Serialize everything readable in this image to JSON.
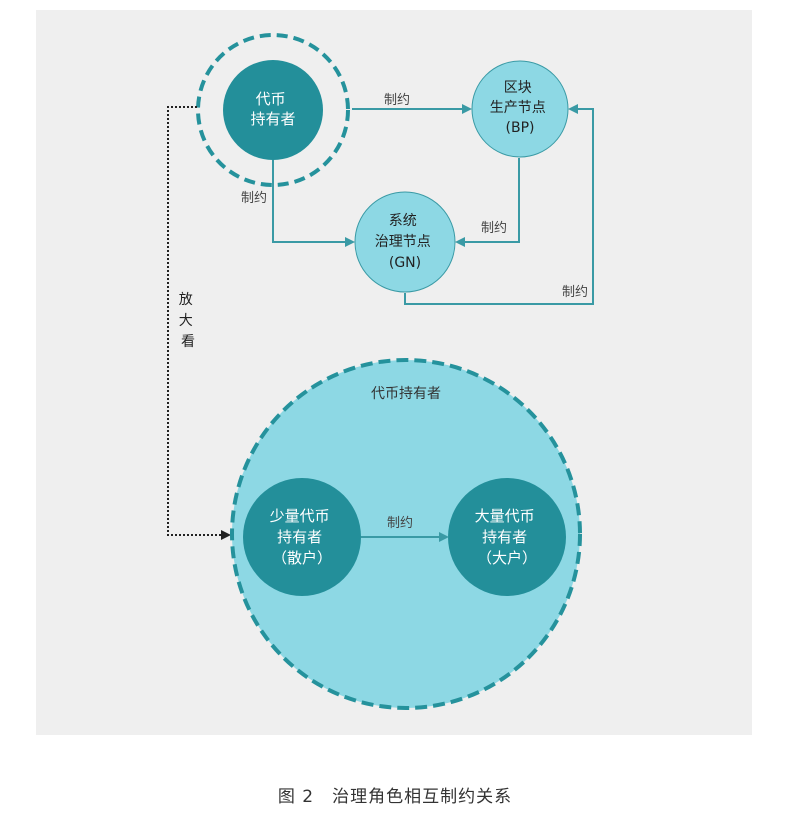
{
  "nodes": {
    "holders_top": {
      "line1": "代币",
      "line2": "持有者"
    },
    "bp": {
      "line1": "区块",
      "line2": "生产节点",
      "line3": "(BP)"
    },
    "gn": {
      "line1": "系统",
      "line2": "治理节点",
      "line3": "(GN)"
    },
    "zoom_title": "代币持有者",
    "retail": {
      "line1": "少量代币",
      "line2": "持有者",
      "line3": "（散户）"
    },
    "whale": {
      "line1": "大量代币",
      "line2": "持有者",
      "line3": "（大户）"
    }
  },
  "edges": {
    "holders_to_bp": "制约",
    "holders_to_gn": "制约",
    "bp_to_gn": "制约",
    "gn_to_bp": "制约",
    "retail_to_whale": "制约"
  },
  "zoom_label": [
    "放",
    "大",
    "看"
  ],
  "caption": "图 2　治理角色相互制约关系",
  "colors": {
    "dark_teal": "#238f9a",
    "light_teal": "#8dd8e4",
    "arrow": "#3a9aa5",
    "dashed_ring": "#25929c",
    "panel_bg": "#efefef"
  }
}
